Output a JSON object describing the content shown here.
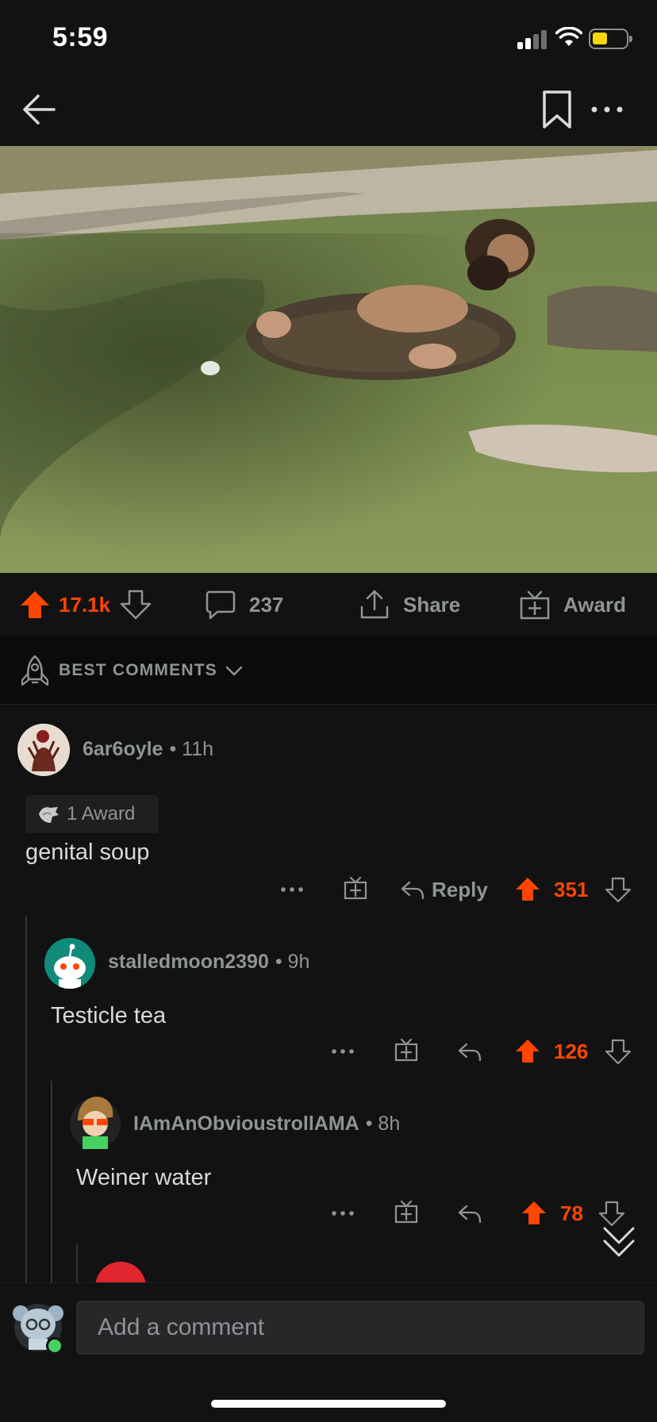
{
  "status_bar": {
    "time": "5:59"
  },
  "post": {
    "score": "17.1k",
    "comments": "237",
    "share_label": "Share",
    "award_label": "Award"
  },
  "sort": {
    "label": "BEST COMMENTS"
  },
  "comments": [
    {
      "user": "6ar6oyle",
      "meta": "• 11h",
      "awards": "1 Award",
      "body": "genital soup",
      "reply_label": "Reply",
      "score": "351"
    },
    {
      "user": "stalledmoon2390",
      "meta": "• 9h",
      "body": "Testicle tea",
      "score": "126"
    },
    {
      "user": "IAmAnObvioustrollAMA",
      "meta": "• 8h",
      "body": "Weiner water",
      "score": "78"
    }
  ],
  "composer": {
    "placeholder": "Add a comment"
  },
  "colors": {
    "accent": "#ff4500",
    "background": "#121212",
    "muted": "#8f9496"
  }
}
